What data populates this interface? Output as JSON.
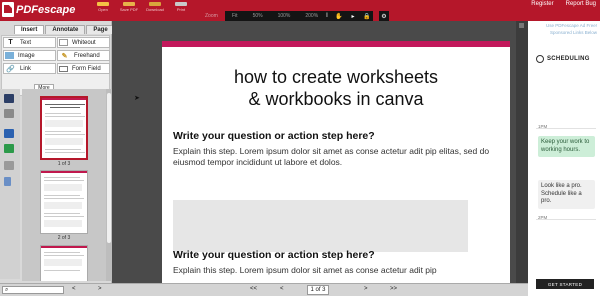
{
  "topbar": {
    "logo_text": "PDFescape",
    "tools": [
      "Open",
      "Save PDF",
      "Download",
      "Print",
      "Share"
    ],
    "zoom_label": "Zoom",
    "zoom_options": [
      "Fit",
      "50%",
      "100%",
      "200%"
    ],
    "links": [
      "Register",
      "Report Bug"
    ]
  },
  "left_panel": {
    "tabs": [
      "Insert",
      "Annotate",
      "Page"
    ],
    "active_tab": "Insert",
    "insert_buttons": [
      {
        "label": "Text",
        "icon": "text-T-icon"
      },
      {
        "label": "Whiteout",
        "icon": "whiteout-icon"
      },
      {
        "label": "Image",
        "icon": "image-icon"
      },
      {
        "label": "Freehand",
        "icon": "pencil-icon"
      },
      {
        "label": "Link",
        "icon": "link-icon"
      },
      {
        "label": "Form Field",
        "icon": "form-field-icon"
      }
    ],
    "more_label": "More",
    "thumbnails": [
      {
        "label": "1 of 3",
        "selected": true
      },
      {
        "label": "2 of 3",
        "selected": false
      },
      {
        "label": "",
        "selected": false
      }
    ]
  },
  "document": {
    "title_line1": "how to create worksheets",
    "title_line2": "& workbooks in canva",
    "q1_head": "Write your question or action step here?",
    "q1_body": "Explain this step. Lorem ipsum dolor sit amet as conse actetur adit pip elitas, sed do eiusmod tempor incididunt ut labore et dolos.",
    "q2_head": "Write your question or action step here?",
    "q2_body": "Explain this step. Lorem ipsum dolor sit amet as conse actetur adit pip"
  },
  "ads": {
    "note_line1": "Use PDFescape Ad Free!",
    "note_line2": "Sponsored Links Below",
    "brand": "SCHEDULING",
    "time1": "1PM",
    "card1": "Keep your work to working hours.",
    "card2": "Look like a pro. Schedule like a pro.",
    "time2": "2PM",
    "cta": "GET STARTED"
  },
  "bottombar": {
    "search_placeholder": "",
    "prev": "<",
    "next": ">",
    "page_value": "1 of 3",
    "page_of": "",
    "first": "<<",
    "last": ">>"
  },
  "colors": {
    "brand_red": "#b5172a",
    "page_accent": "#c2185b"
  }
}
